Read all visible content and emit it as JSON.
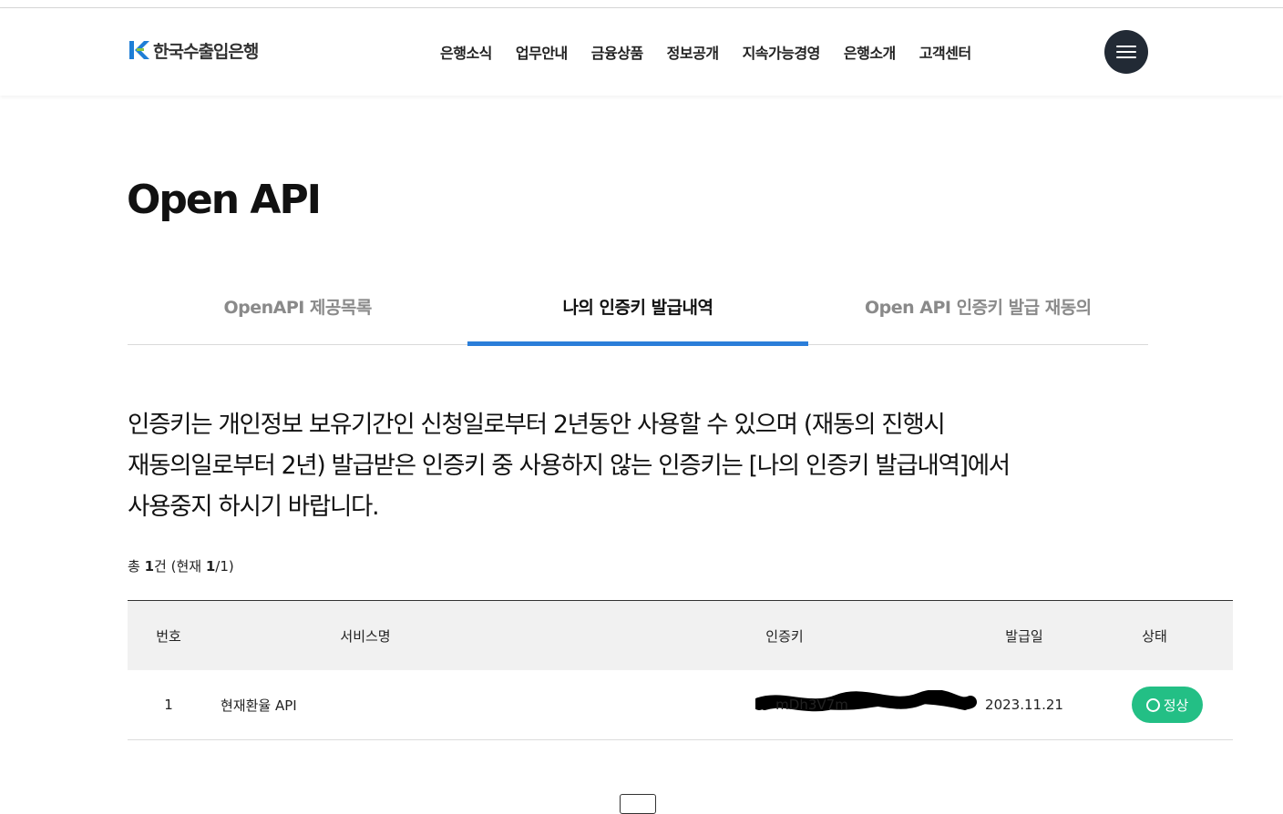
{
  "header": {
    "logo_text": "한국수출입은행",
    "nav": [
      "은행소식",
      "업무안내",
      "금융상품",
      "정보공개",
      "지속가능경영",
      "은행소개",
      "고객센터"
    ],
    "menu_icon": "hamburger-icon"
  },
  "page": {
    "title": "Open API"
  },
  "tabs": [
    {
      "label": "OpenAPI 제공목록"
    },
    {
      "label": "나의 인증키 발급내역"
    },
    {
      "label": "Open API 인증키 발급 재동의"
    }
  ],
  "notice": {
    "line1": "인증키는 개인정보 보유기간인 신청일로부터 2년동안 사용할 수 있으며 (재동의 진행시",
    "line2": "재동의일로부터 2년) 발급받은 인증키 중 사용하지 않는 인증키는 [나의 인증키 발급내역]에서",
    "line3": "사용중지 하시기 바랍니다."
  },
  "count": {
    "prefix": "총",
    "total": "1",
    "unit": "건 (현재",
    "current": "1",
    "pages": "/1)"
  },
  "table": {
    "headers": [
      "번호",
      "서비스명",
      "인증키",
      "발급일",
      "상태"
    ],
    "rows": [
      {
        "num": "1",
        "service": "현재환율 API",
        "key_visible": "mDh3V7m",
        "date": "2023.11.21",
        "status": "정상"
      }
    ]
  },
  "colors": {
    "accent": "#2b7ed9",
    "status_ok": "#23bf85",
    "menu_button": "#222a35",
    "logo_blue": "#1f7ed6"
  }
}
